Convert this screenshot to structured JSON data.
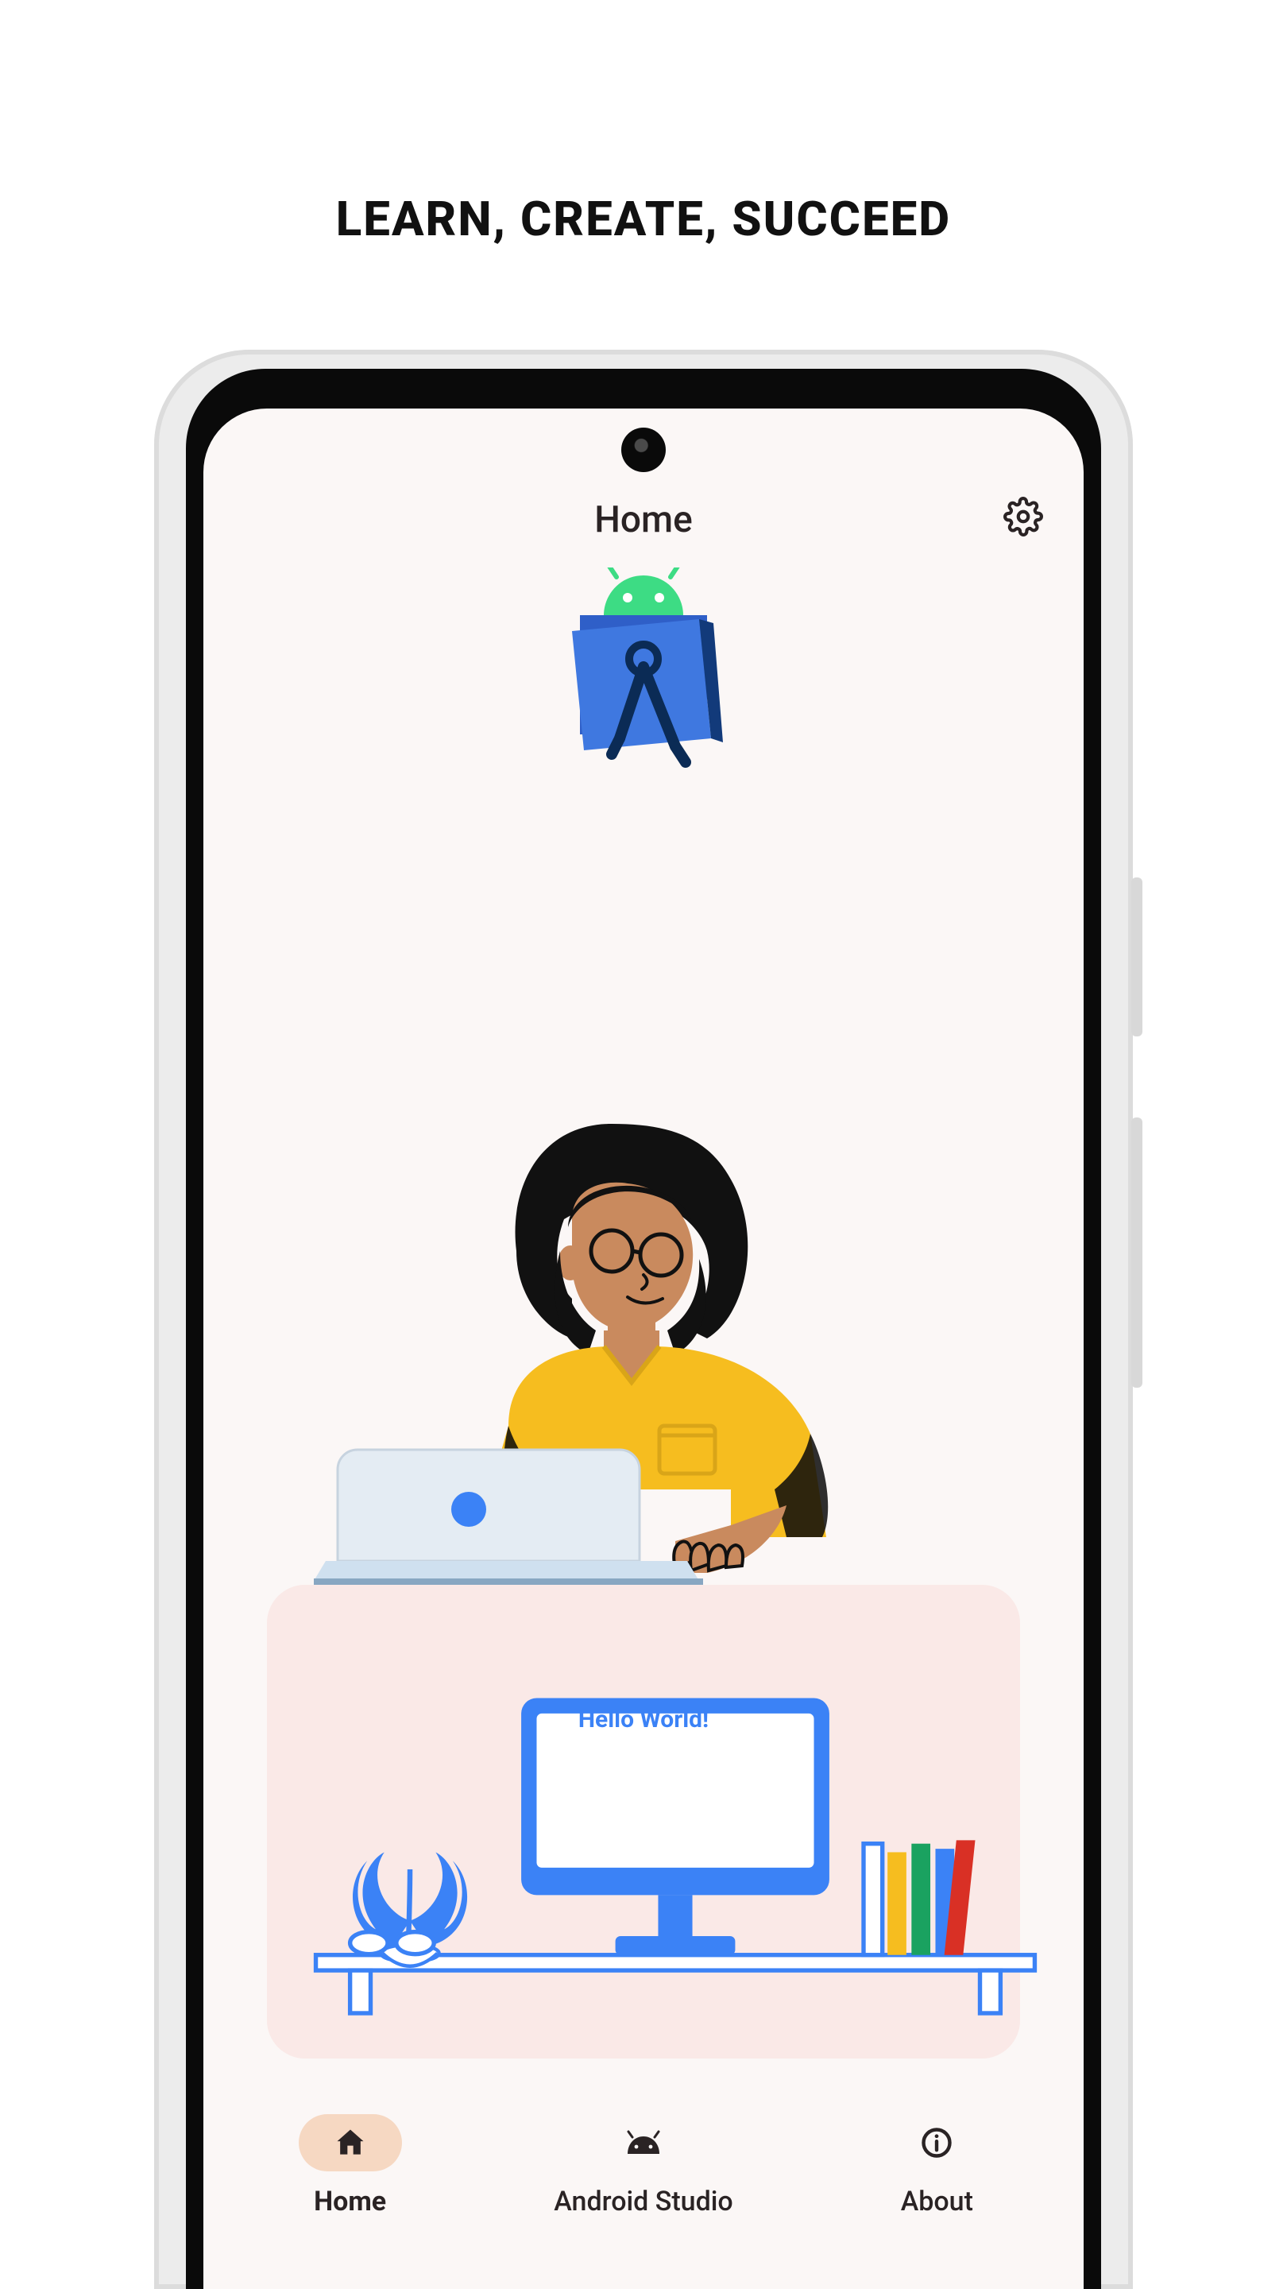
{
  "marketing": {
    "tagline": "LEARN, CREATE, SUCCEED"
  },
  "header": {
    "title": "Home",
    "settings_icon": "gear-icon"
  },
  "hero": {
    "logo_icon": "android-studio-logo",
    "illustration": "person-coding-laptop",
    "desk_monitor_text": "Hello World!"
  },
  "bottom_nav": {
    "items": [
      {
        "icon": "home-icon",
        "label": "Home",
        "active": true
      },
      {
        "icon": "android-icon",
        "label": "Android Studio",
        "active": false
      },
      {
        "icon": "info-icon",
        "label": "About",
        "active": false
      }
    ]
  },
  "colors": {
    "screen_bg": "#fbf7f6",
    "desk_card_bg": "#fae9e7",
    "nav_pill_active": "#f6d8c2",
    "text_dark": "#2a2324",
    "accent_blue": "#3b82f6",
    "android_green": "#3ddc84",
    "shirt_yellow": "#f6bd1f",
    "folder_blue": "#3f78e0"
  }
}
